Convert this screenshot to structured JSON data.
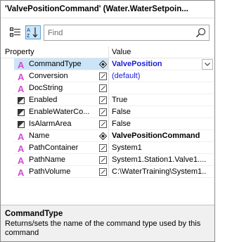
{
  "window": {
    "title": "'ValvePositionCommand' (Water.WaterSetpoin..."
  },
  "toolbar": {
    "categorized_icon": "categorized-icon",
    "alphabetical_icon": "alphabetical-sort-icon",
    "search_placeholder": "Find",
    "search_value": "",
    "search_icon": "search-icon"
  },
  "grid": {
    "col_property": "Property",
    "col_value": "Value",
    "rows": [
      {
        "icon": "text-a-icon",
        "name": "CommandType",
        "flag": "diamond-icon",
        "value": "ValvePosition",
        "style": "bluebold",
        "selected": true,
        "dropdown": true
      },
      {
        "icon": "text-a-icon",
        "name": "Conversion",
        "flag": "edit-box-icon",
        "value": "(default)",
        "style": "blue"
      },
      {
        "icon": "text-a-icon",
        "name": "DocString",
        "flag": "edit-box-icon",
        "value": ""
      },
      {
        "icon": "boolean-icon",
        "name": "Enabled",
        "flag": "edit-box-icon",
        "value": "True"
      },
      {
        "icon": "boolean-icon",
        "name": "EnableWaterCo...",
        "flag": "edit-box-icon",
        "value": "False"
      },
      {
        "icon": "boolean-icon",
        "name": "IsAlarmArea",
        "flag": "edit-box-icon",
        "value": "False"
      },
      {
        "icon": "text-a-icon",
        "name": "Name",
        "flag": "diamond-icon",
        "value": "ValvePositionCommand",
        "style": "bold"
      },
      {
        "icon": "text-a-icon",
        "name": "PathContainer",
        "flag": "edit-box-icon",
        "value": "System1"
      },
      {
        "icon": "text-a-icon",
        "name": "PathName",
        "flag": "edit-box-icon",
        "value": "System1.Station1.Valve1...."
      },
      {
        "icon": "text-a-icon",
        "name": "PathVolume",
        "flag": "edit-box-icon",
        "value": "C:\\WaterTraining\\System1..."
      }
    ]
  },
  "description": {
    "title": "CommandType",
    "text": "Returns/sets the name of the command type used by this command"
  },
  "colors": {
    "selection": "#cce4f7",
    "value_blue": "#1a1fd6",
    "string_icon": "#d24bd2",
    "desc_bg": "#f0f0f0"
  }
}
